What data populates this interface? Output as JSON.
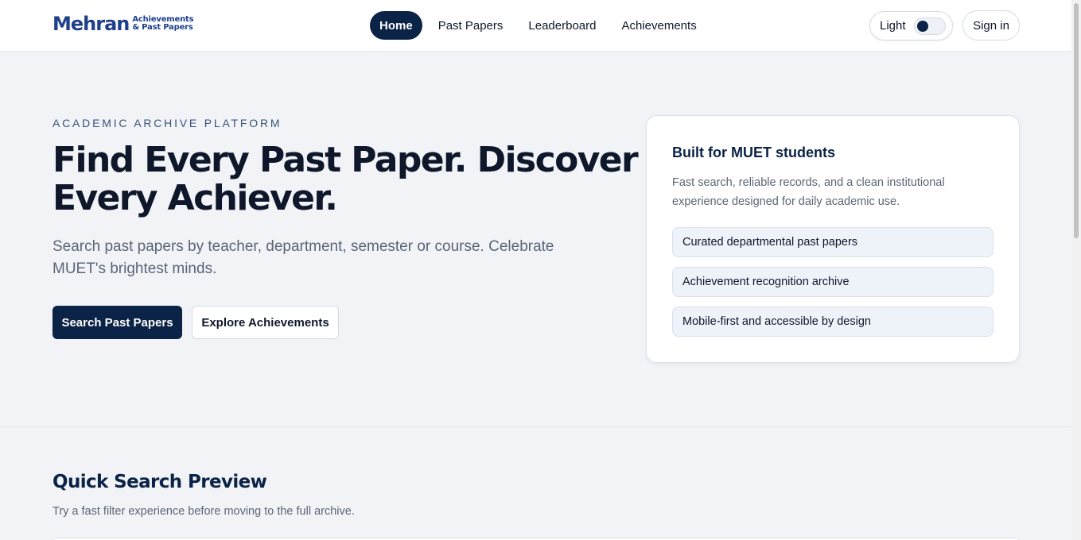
{
  "header": {
    "logo_main": "Mehran",
    "logo_sub_line1": "Achievements",
    "logo_sub_line2": "& Past Papers",
    "nav": [
      {
        "label": "Home",
        "active": true
      },
      {
        "label": "Past Papers",
        "active": false
      },
      {
        "label": "Leaderboard",
        "active": false
      },
      {
        "label": "Achievements",
        "active": false
      }
    ],
    "theme_label": "Light",
    "signin_label": "Sign in"
  },
  "hero": {
    "eyebrow": "ACADEMIC ARCHIVE PLATFORM",
    "title": "Find Every Past Paper. Discover Every Achiever.",
    "subtitle": "Search past papers by teacher, department, semester or course. Celebrate MUET's brightest minds.",
    "primary_button": "Search Past Papers",
    "secondary_button": "Explore Achievements"
  },
  "card": {
    "title": "Built for MUET students",
    "description": "Fast search, reliable records, and a clean institutional experience designed for daily academic use.",
    "features": [
      "Curated departmental past papers",
      "Achievement recognition archive",
      "Mobile-first and accessible by design"
    ]
  },
  "quick_search": {
    "title": "Quick Search Preview",
    "subtitle": "Try a fast filter experience before moving to the full archive."
  },
  "colors": {
    "brand_navy": "#0b2346",
    "logo_blue": "#1d3f8c",
    "page_bg": "#f1f3f7"
  }
}
